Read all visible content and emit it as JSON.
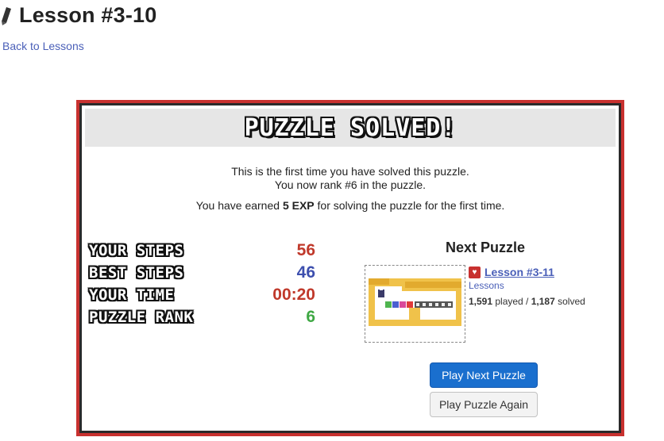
{
  "page": {
    "title": "Lesson #3-10",
    "back_link": "Back to Lessons"
  },
  "modal": {
    "banner_title": "PUZZLE SOLVED!",
    "msg_line1": "This is the first time you have solved this puzzle.",
    "msg_line2": "You now rank #6 in the puzzle.",
    "msg_line3_prefix": "You have earned ",
    "msg_line3_exp": "5 EXP",
    "msg_line3_suffix": " for solving the puzzle for the first time.",
    "stats": [
      {
        "label": "YOUR STEPS",
        "value": "56",
        "color": "#c0392b"
      },
      {
        "label": "BEST STEPS",
        "value": "46",
        "color": "#3d4fae"
      },
      {
        "label": "YOUR TIME",
        "value": "00:20",
        "color": "#c0392b"
      },
      {
        "label": "PUZZLE RANK",
        "value": "6",
        "color": "#3fa844"
      }
    ],
    "next_puzzle": {
      "heading": "Next Puzzle",
      "lesson_title": "Lesson #3-11",
      "category": "Lessons",
      "played_count": "1,591",
      "played_text": " played / ",
      "solved_count": "1,187",
      "solved_text": " solved",
      "thumbnail_icon": "puzzle-thumbnail",
      "badge_icon": "heart-icon"
    },
    "buttons": {
      "play_next": "Play Next Puzzle",
      "play_again": "Play Puzzle Again"
    }
  },
  "colors": {
    "border": "#c8312f",
    "primary": "#1a6fce",
    "link": "#4a5fb8"
  }
}
